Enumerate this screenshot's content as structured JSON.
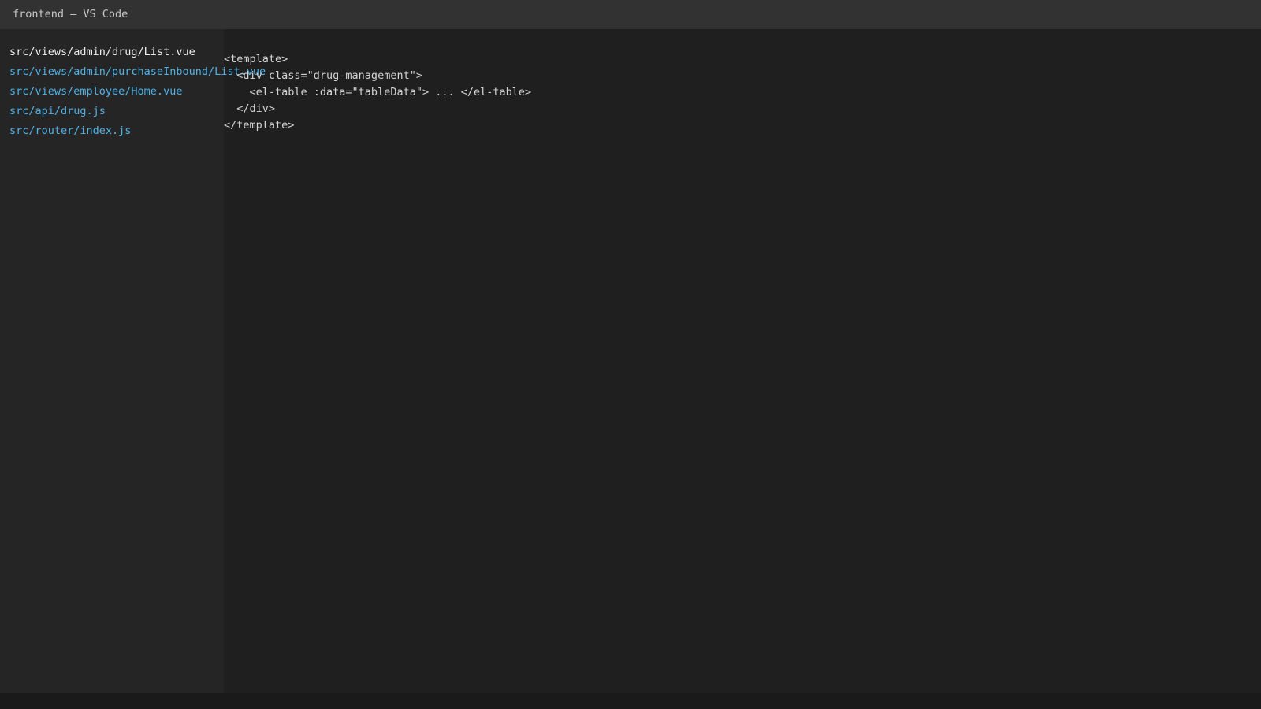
{
  "window": {
    "title": "frontend — VS Code"
  },
  "sidebar": {
    "files": [
      {
        "path": "src/views/admin/drug/List.vue",
        "active": true
      },
      {
        "path": "src/views/admin/purchaseInbound/List.vue",
        "active": false
      },
      {
        "path": "src/views/employee/Home.vue",
        "active": false
      },
      {
        "path": "src/api/drug.js",
        "active": false
      },
      {
        "path": "src/router/index.js",
        "active": false
      }
    ]
  },
  "editor": {
    "lines": [
      "<template>",
      "  <div class=\"drug-management\">",
      "    <el-table :data=\"tableData\"> ... </el-table>",
      "  </div>",
      "</template>"
    ]
  },
  "colors": {
    "background": "#1f1f1f",
    "titlebar": "#323232",
    "sidebar": "#252526",
    "file_link": "#4fb3e8",
    "active_file": "#f0f0f0",
    "code_text": "#d4d4d4"
  }
}
